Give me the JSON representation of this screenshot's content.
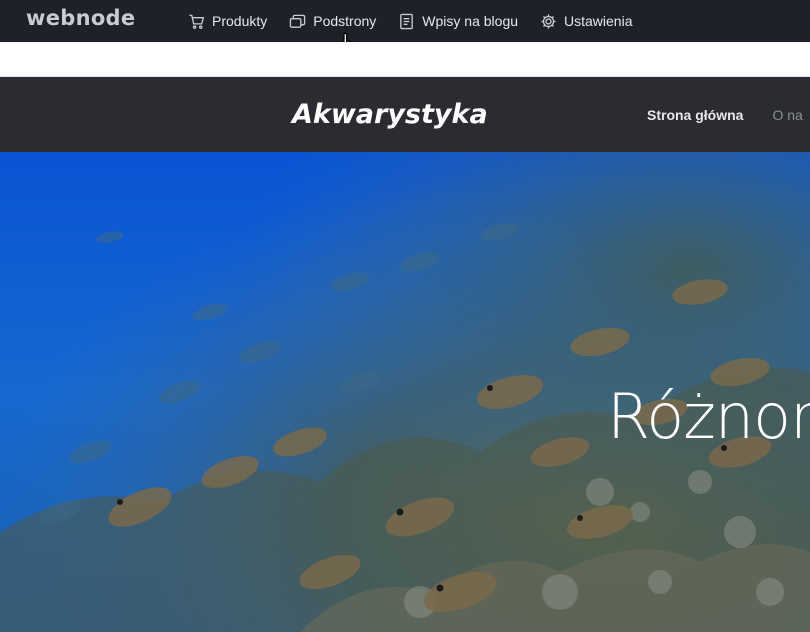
{
  "editor": {
    "logo": "webnode",
    "nav": [
      {
        "label": "Produkty",
        "icon": "cart-icon"
      },
      {
        "label": "Podstrony",
        "icon": "pages-icon"
      },
      {
        "label": "Wpisy na blogu",
        "icon": "document-icon"
      },
      {
        "label": "Ustawienia",
        "icon": "gear-icon"
      }
    ]
  },
  "site": {
    "title": "Akwarystyka",
    "nav": [
      {
        "label": "Strona główna",
        "active": true
      },
      {
        "label": "O na",
        "active": false
      }
    ]
  },
  "hero": {
    "heading": "Różnoro"
  },
  "colors": {
    "editor_bar": "#1e2129",
    "site_header": "#2a2c31",
    "ocean": "#1462c8"
  }
}
